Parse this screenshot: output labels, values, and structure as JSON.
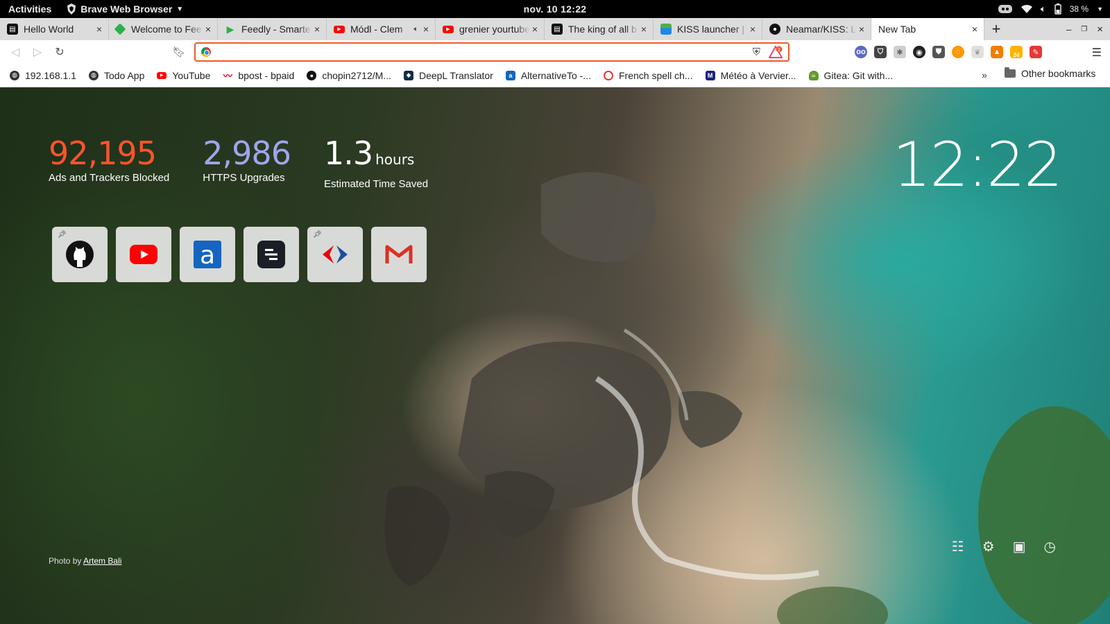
{
  "topbar": {
    "activities": "Activities",
    "app_name": "Brave Web Browser",
    "clock": "nov. 10  12:22",
    "battery": "38 %"
  },
  "tabs": [
    {
      "title": "Hello World",
      "favicon": "notion-icon",
      "color": "#111111"
    },
    {
      "title": "Welcome to Fee",
      "favicon": "feedly-diamond-icon",
      "color": "#2bb24c"
    },
    {
      "title": "Feedly - Smarte",
      "favicon": "feedly-play-icon",
      "color": "#2bb24c"
    },
    {
      "title": "Módl - Clem",
      "favicon": "youtube-icon",
      "color": "#ff0000",
      "muted": true
    },
    {
      "title": "grenier yourtube",
      "favicon": "youtube-icon",
      "color": "#ff0000"
    },
    {
      "title": "The king of all b",
      "favicon": "notion-icon",
      "color": "#111111"
    },
    {
      "title": "KISS launcher |",
      "favicon": "kiss-icon",
      "color": "#1e88e5"
    },
    {
      "title": "Neamar/KISS: L",
      "favicon": "github-icon",
      "color": "#111111"
    },
    {
      "title": "New Tab",
      "favicon": "",
      "color": "",
      "active": true
    }
  ],
  "omnibox": {
    "value": "",
    "placeholder": ""
  },
  "bookmarks": [
    {
      "label": "192.168.1.1",
      "icon": "globe-icon",
      "color": "#333333"
    },
    {
      "label": "Todo App",
      "icon": "globe-icon",
      "color": "#333333"
    },
    {
      "label": "YouTube",
      "icon": "youtube-icon",
      "color": "#ff0000"
    },
    {
      "label": "bpost - bpaid",
      "icon": "bpost-icon",
      "color": "#e2001a"
    },
    {
      "label": "chopin2712/M...",
      "icon": "github-icon",
      "color": "#111111"
    },
    {
      "label": "DeepL Translator",
      "icon": "deepl-icon",
      "color": "#0f2b46"
    },
    {
      "label": "AlternativeTo -...",
      "icon": "alternativeto-icon",
      "color": "#1565c0"
    },
    {
      "label": "French spell ch...",
      "icon": "spellcheck-icon",
      "color": "#e53935"
    },
    {
      "label": "Météo à Vervier...",
      "icon": "meteo-icon",
      "color": "#1a237e"
    },
    {
      "label": "Gitea: Git with...",
      "icon": "gitea-icon",
      "color": "#609926"
    }
  ],
  "bookmarks_more": "»",
  "other_bookmarks": "Other bookmarks",
  "stats": {
    "ads_blocked": "92,195",
    "ads_blocked_label": "Ads and Trackers Blocked",
    "https_upgrades": "2,986",
    "https_upgrades_label": "HTTPS Upgrades",
    "time_saved": "1.3",
    "time_saved_unit": "hours",
    "time_saved_label": "Estimated Time Saved",
    "colors": {
      "ads": "#fb542b",
      "https": "#a0a5eb",
      "time": "#ffffff"
    }
  },
  "ntp_clock": "12:22",
  "top_sites": [
    {
      "name": "github",
      "icon": "github-icon",
      "pinned": true
    },
    {
      "name": "youtube",
      "icon": "youtube-icon",
      "pinned": false
    },
    {
      "name": "alternativeto",
      "icon": "alternativeto-icon",
      "pinned": false
    },
    {
      "name": "notion",
      "icon": "notion-icon",
      "pinned": false
    },
    {
      "name": "carrefour",
      "icon": "carrefour-icon",
      "pinned": true
    },
    {
      "name": "gmail",
      "icon": "gmail-icon",
      "pinned": false
    }
  ],
  "credit": {
    "prefix": "Photo by",
    "author": "Artem Bali"
  },
  "ntp_tools": [
    "customize-icon",
    "settings-icon",
    "bookmarks-icon",
    "history-icon"
  ]
}
